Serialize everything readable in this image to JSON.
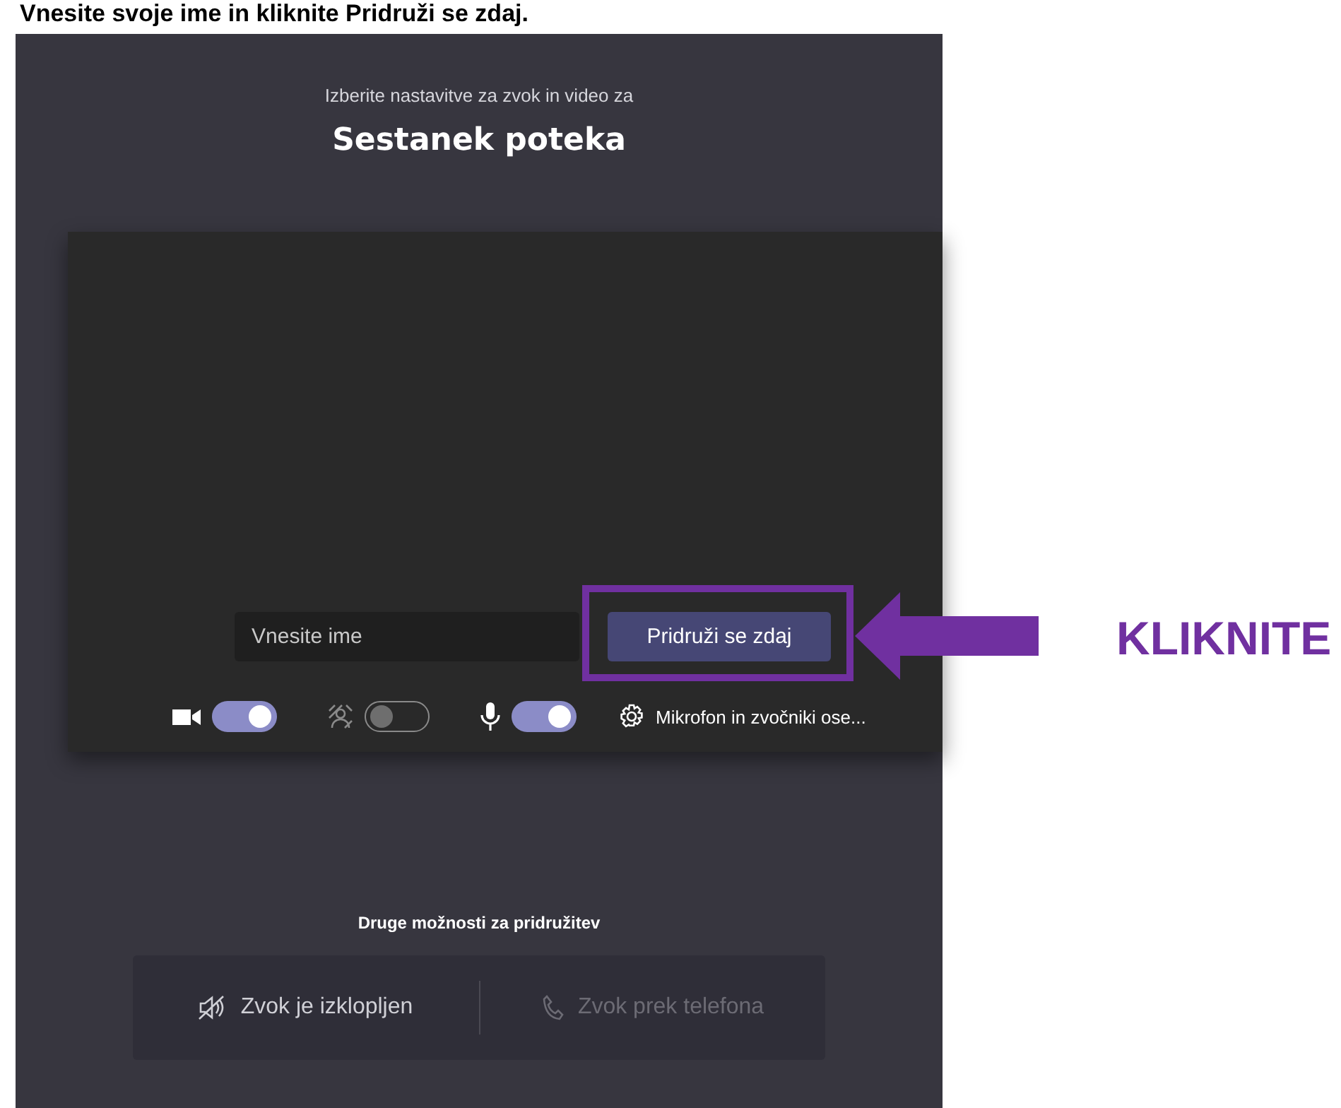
{
  "instruction": "Vnesite svoje ime in kliknite Pridruži se zdaj.",
  "prejoin": {
    "subtitle": "Izberite nastavitve za zvok in video za",
    "title": "Sestanek poteka",
    "name_field": {
      "placeholder": "Vnesite ime"
    },
    "join_button": "Pridruži se zdaj",
    "controls": [
      {
        "kind": "camera",
        "on": true
      },
      {
        "kind": "blur",
        "on": false
      },
      {
        "kind": "mic",
        "on": true
      }
    ],
    "device_settings": "Mikrofon in zvočniki ose...",
    "other_options_title": "Druge možnosti za pridružitev",
    "other_options": [
      {
        "kind": "audio_off",
        "label": "Zvok je izklopljen",
        "disabled": false
      },
      {
        "kind": "phone",
        "label": "Zvok prek telefona",
        "disabled": true
      }
    ]
  },
  "annotation": {
    "label": "KLIKNITE"
  }
}
